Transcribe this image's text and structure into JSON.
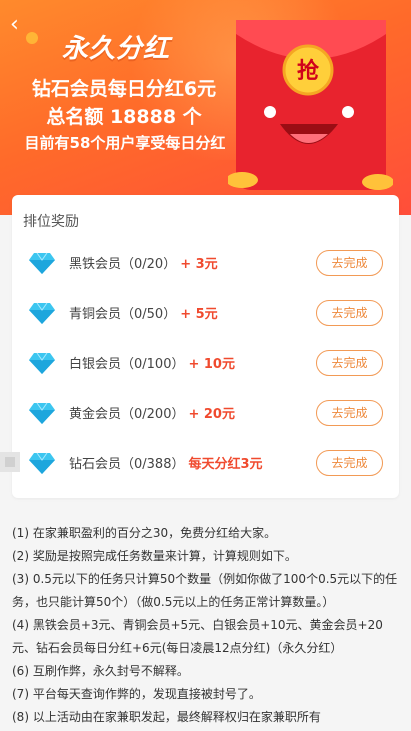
{
  "header": {
    "title": "永久分红",
    "line1": "钻石会员每日分红6元",
    "line2": "总名额 18888 个",
    "line3": "目前有58个用户享受每日分红",
    "envelope_char": "抢"
  },
  "ranking": {
    "title": "排位奖励",
    "button_label": "去完成",
    "items": [
      {
        "name": "黑铁会员（0/20）",
        "reward": "+ 3元"
      },
      {
        "name": "青铜会员（0/50）",
        "reward": "+ 5元"
      },
      {
        "name": "白银会员（0/100）",
        "reward": "+ 10元"
      },
      {
        "name": "黄金会员（0/200）",
        "reward": "+ 20元"
      },
      {
        "name": "钻石会员（0/388）",
        "reward": "每天分红3元"
      }
    ]
  },
  "rules": [
    "(1) 在家兼职盈利的百分之30，免费分红给大家。",
    "(2) 奖励是按照完成任务数量来计算，计算规则如下。",
    "(3) 0.5元以下的任务只计算50个数量（例如你做了100个0.5元以下的任务，也只能计算50个）（做0.5元以上的任务正常计算数量。）",
    "(4) 黑铁会员+3元、青铜会员+5元、白银会员+10元、黄金会员+20元、钻石会员每日分红+6元(每日凌晨12点分红)（永久分红）",
    "(6) 互刷作弊，永久封号不解释。",
    "(7) 平台每天查询作弊的，发现直接被封号了。",
    "(8) 以上活动由在家兼职发起，最终解释权归在家兼职所有"
  ],
  "colors": {
    "accent": "#ff6a2a",
    "reward": "#f04a2e",
    "button": "#ee8a3d"
  }
}
